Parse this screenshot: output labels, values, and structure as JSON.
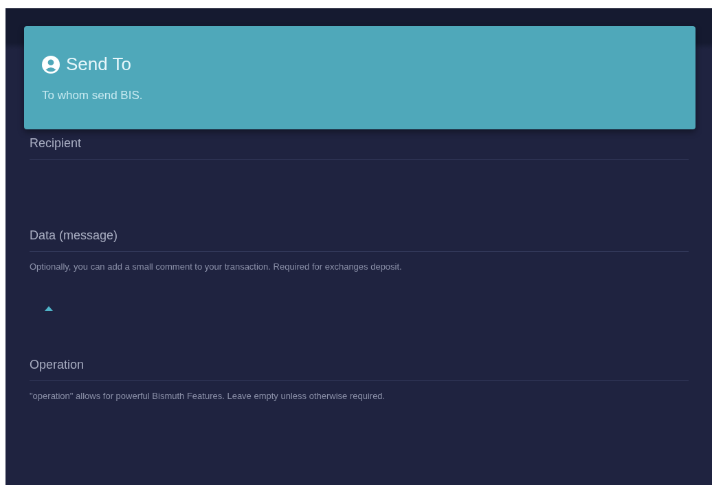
{
  "header": {
    "title": "Send To",
    "subtitle": "To whom send BIS."
  },
  "fields": [
    {
      "placeholder": "Recipient"
    },
    {
      "placeholder": "Data (message)",
      "hint": "Optionally, you can add a small comment to your transaction. Required for exchanges deposit."
    }
  ],
  "advanced_toggle": {
    "expanded": true
  },
  "advanced_fields": [
    {
      "placeholder": "Operation",
      "hint": "\"operation\" allows for powerful Bismuth Features. Leave empty unless otherwise required."
    }
  ]
}
